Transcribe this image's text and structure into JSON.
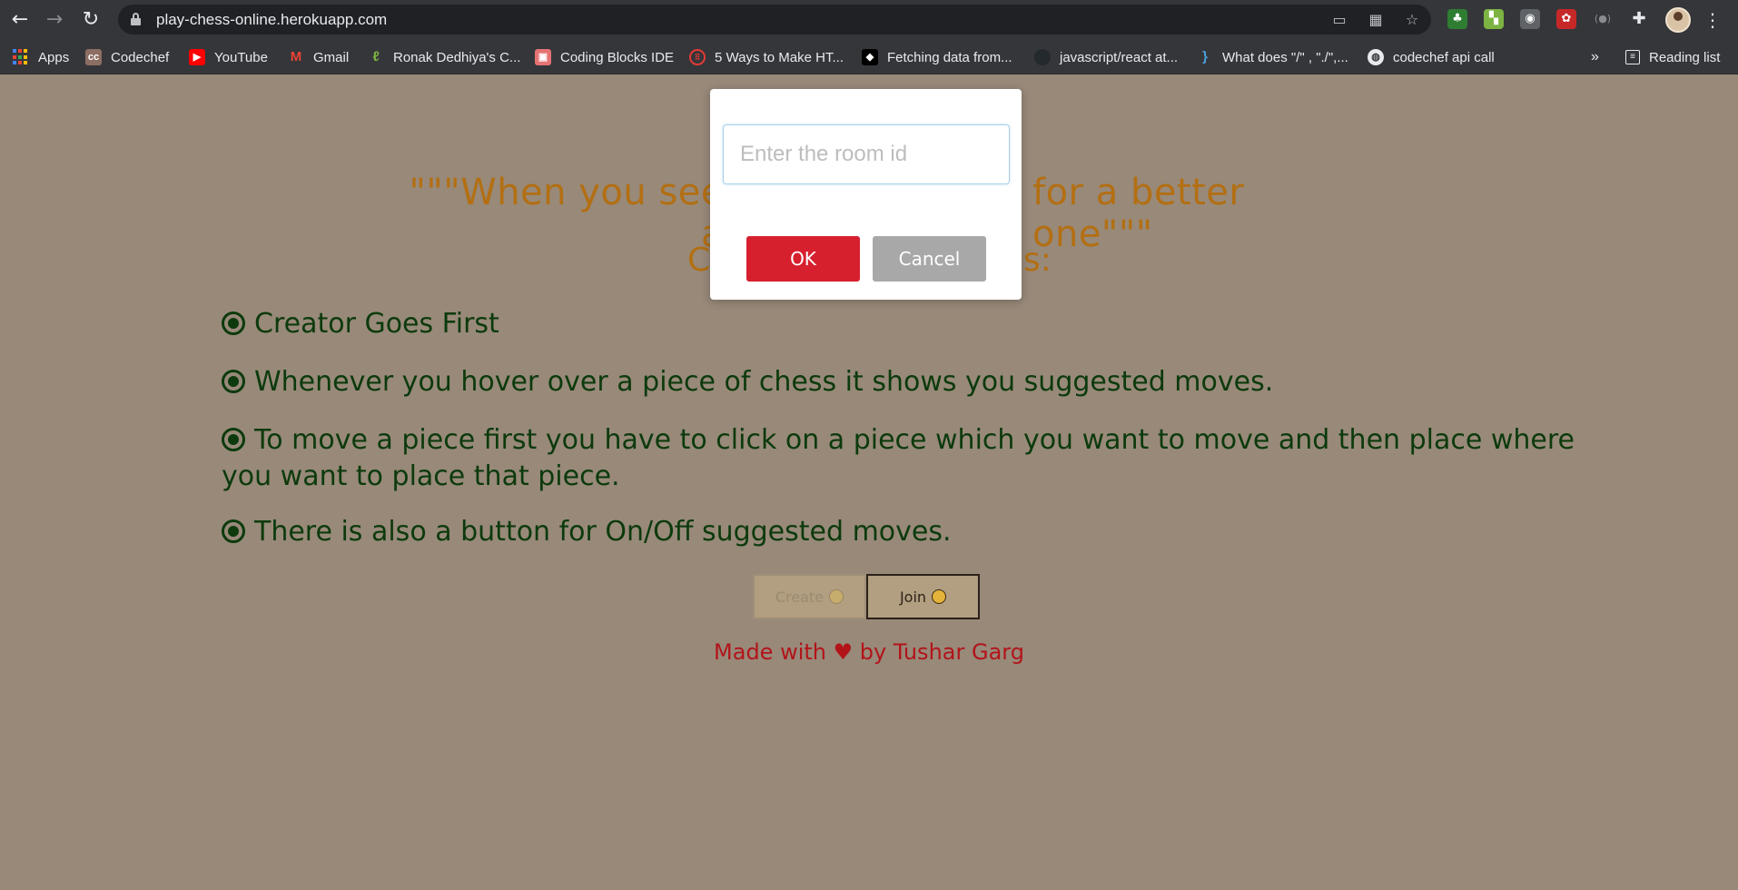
{
  "browser": {
    "url": "play-chess-online.herokuapp.com",
    "bookmarks": [
      {
        "label": "Apps",
        "icon": "apps-grid-icon"
      },
      {
        "label": "Codechef",
        "icon": "codechef-icon"
      },
      {
        "label": "YouTube",
        "icon": "youtube-icon"
      },
      {
        "label": "Gmail",
        "icon": "gmail-icon"
      },
      {
        "label": "Ronak Dedhiya's C...",
        "icon": "leetcode-icon"
      },
      {
        "label": "Coding Blocks IDE",
        "icon": "coding-blocks-icon"
      },
      {
        "label": "5 Ways to Make HT...",
        "icon": "site-icon"
      },
      {
        "label": "Fetching data from...",
        "icon": "site-icon"
      },
      {
        "label": "javascript/react at...",
        "icon": "github-icon"
      },
      {
        "label": "What does \"/\" , \"./\",...",
        "icon": "site-icon"
      },
      {
        "label": "codechef api call",
        "icon": "globe-icon"
      }
    ],
    "overflow": "»",
    "reading_list": "Reading list"
  },
  "page": {
    "quote_left": "\"\"\"When you see a",
    "quote_right": "for a better one\"\"\"",
    "subtitle_left": "C",
    "subtitle_right": "s:",
    "rules": [
      "Creator Goes First",
      "Whenever you hover over a piece of chess it shows you suggested moves.",
      "To move a piece first you have to click on a piece which you want to move and then place where you want to place that piece.",
      "There is also a button for On/Off suggested moves."
    ],
    "create_label": "Create",
    "join_label": "Join",
    "credit": "Made with ♥ by Tushar Garg"
  },
  "dialog": {
    "placeholder": "Enter the room id",
    "ok_label": "OK",
    "cancel_label": "Cancel"
  },
  "colors": {
    "page_bg": "#988979",
    "quote": "#b36f12",
    "rules": "#0c3a0c",
    "credit": "#b2141a",
    "ok": "#d6202e",
    "cancel": "#a8a8a8"
  }
}
